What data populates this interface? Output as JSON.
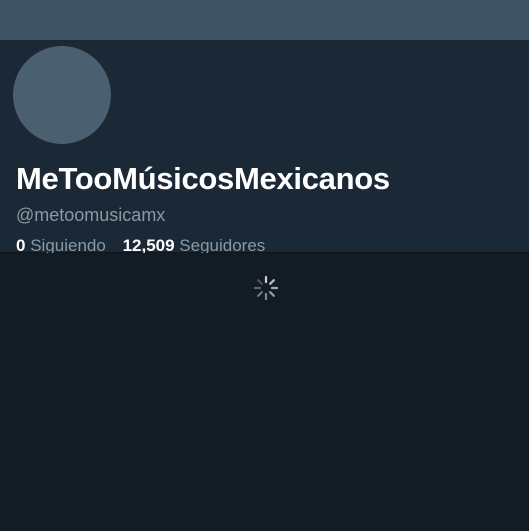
{
  "profile": {
    "display_name": "MeTooMúsicosMexicanos",
    "handle": "@metoomusicamx",
    "following_count": "0",
    "following_label": "Siguiendo",
    "followers_count": "12,509",
    "followers_label": "Seguidores"
  },
  "colors": {
    "banner": "#3e5363",
    "card_background": "#1b2836",
    "feed_background": "#131b24",
    "secondary_text": "#8b98a5"
  },
  "icons": {
    "loading": "loading-spinner-icon"
  }
}
